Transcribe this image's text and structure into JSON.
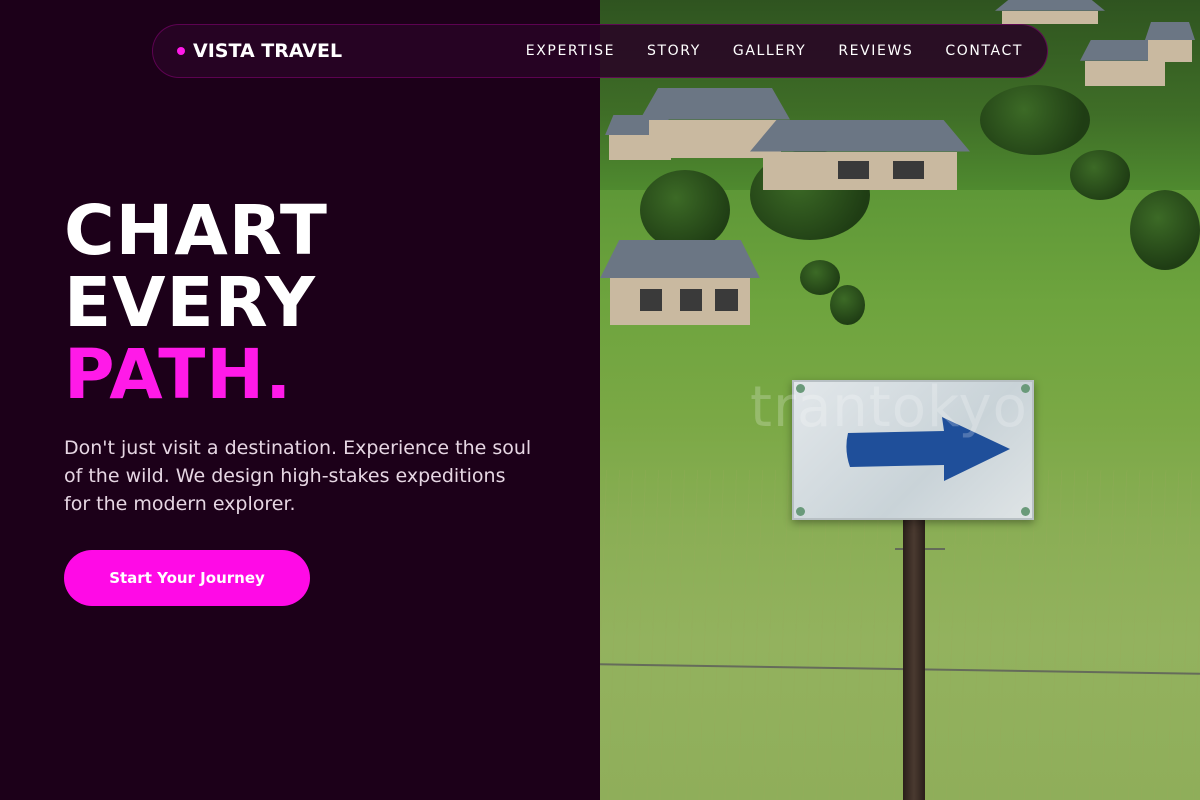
{
  "brand": {
    "name": "VISTA TRAVEL",
    "accent_color": "#ff1ae8"
  },
  "nav": {
    "items": [
      {
        "label": "EXPERTISE"
      },
      {
        "label": "STORY"
      },
      {
        "label": "GALLERY"
      },
      {
        "label": "REVIEWS"
      },
      {
        "label": "CONTACT"
      }
    ]
  },
  "hero": {
    "headline_line1": "CHART",
    "headline_line2": "EVERY",
    "headline_line3": "PATH.",
    "subtitle": "Don't just visit a destination. Experience the soul of the wild. We design high-stakes expeditions for the modern explorer.",
    "cta_label": "Start Your Journey"
  },
  "photo": {
    "watermark": "trantokyo",
    "sign_icon": "arrow-right-icon"
  },
  "colors": {
    "background": "#1c0019",
    "accent": "#ff1ae8",
    "text": "#ffffff"
  }
}
